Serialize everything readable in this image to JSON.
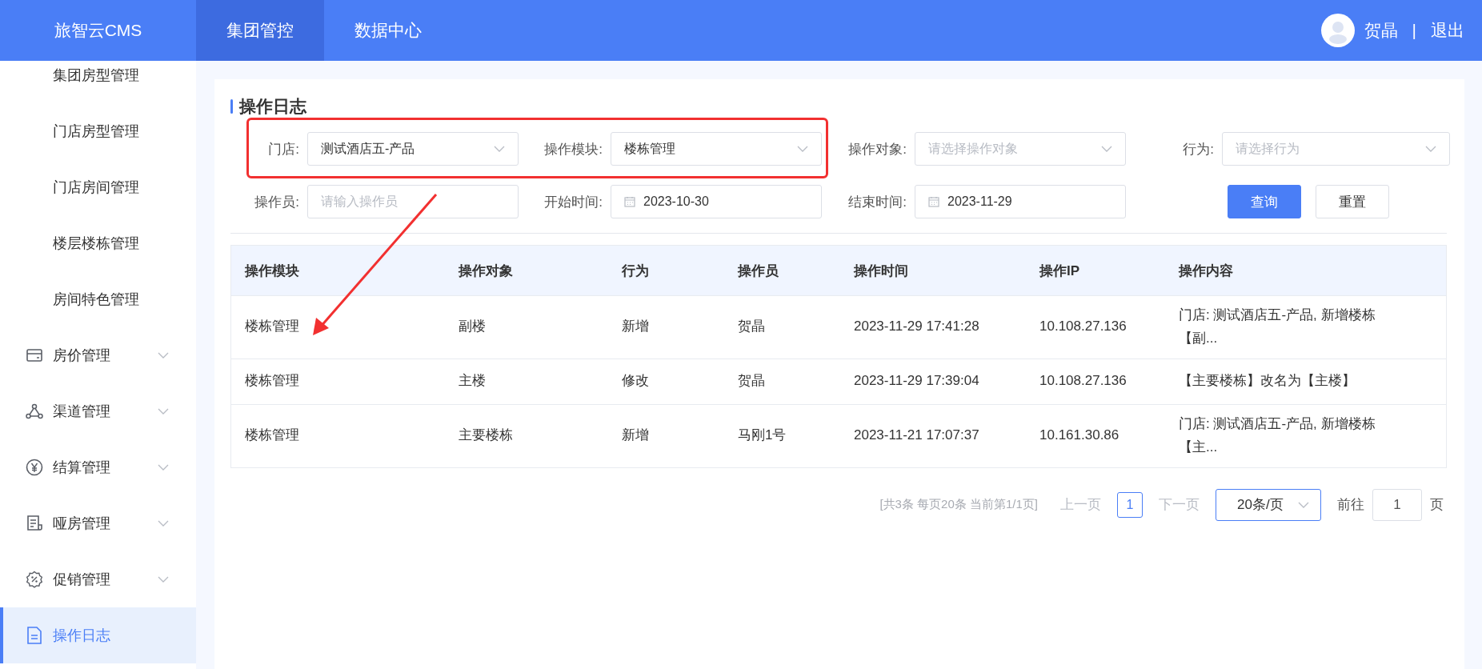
{
  "header": {
    "logo": "旅智云CMS",
    "nav": [
      {
        "label": "集团管控",
        "selected": true
      },
      {
        "label": "数据中心",
        "selected": false
      }
    ],
    "user": "贺晶",
    "separator": "|",
    "logout": "退出"
  },
  "sidebar": {
    "items": [
      {
        "kind": "link",
        "label": "集团房型管理",
        "selected": false
      },
      {
        "kind": "link",
        "label": "门店房型管理",
        "selected": false
      },
      {
        "kind": "link",
        "label": "门店房间管理",
        "selected": false
      },
      {
        "kind": "link",
        "label": "楼层楼栋管理",
        "selected": false
      },
      {
        "kind": "link",
        "label": "房间特色管理",
        "selected": false
      },
      {
        "kind": "group",
        "label": "房价管理",
        "expanded": false,
        "selected": false
      },
      {
        "kind": "group",
        "label": "渠道管理",
        "expanded": false,
        "selected": false
      },
      {
        "kind": "group",
        "label": "结算管理",
        "expanded": false,
        "selected": false
      },
      {
        "kind": "group",
        "label": "哑房管理",
        "expanded": false,
        "selected": false
      },
      {
        "kind": "group",
        "label": "促销管理",
        "expanded": false,
        "selected": false
      },
      {
        "kind": "page",
        "label": "操作日志",
        "selected": true
      }
    ]
  },
  "page": {
    "title": "操作日志",
    "filters": [
      {
        "kind": "select",
        "label": "门店:",
        "value": "测试酒店五-产品"
      },
      {
        "kind": "select",
        "label": "操作模块:",
        "value": "楼栋管理"
      },
      {
        "kind": "select",
        "label": "操作对象:",
        "placeholder": "请选择操作对象"
      },
      {
        "kind": "select",
        "label": "行为:",
        "placeholder": "请选择行为"
      },
      {
        "kind": "input",
        "label": "操作员:",
        "placeholder": "请输入操作员"
      },
      {
        "kind": "date",
        "label": "开始时间:",
        "value": "2023-10-30"
      },
      {
        "kind": "date",
        "label": "结束时间:",
        "value": "2023-11-29"
      }
    ],
    "buttons": [
      {
        "kind": "primary",
        "label": "查询"
      },
      {
        "kind": "plain",
        "label": "重置"
      }
    ],
    "table": {
      "columns": [
        "操作模块",
        "操作对象",
        "行为",
        "操作员",
        "操作时间",
        "操作IP",
        "操作内容"
      ],
      "rows": [
        [
          "楼栋管理",
          "副楼",
          "新增",
          "贺晶",
          "2023-11-29 17:41:28",
          "10.108.27.136",
          "门店: 测试酒店五-产品, 新增楼栋【副..."
        ],
        [
          "楼栋管理",
          "主楼",
          "修改",
          "贺晶",
          "2023-11-29 17:39:04",
          "10.108.27.136",
          "【主要楼栋】改名为【主楼】"
        ],
        [
          "楼栋管理",
          "主要楼栋",
          "新增",
          "马刚1号",
          "2023-11-21 17:07:37",
          "10.161.30.86",
          "门店: 测试酒店五-产品, 新增楼栋【主..."
        ]
      ]
    },
    "pagination": {
      "summary": "[共3条 每页20条 当前第1/1页]",
      "prev": {
        "label": "上一页",
        "disabled": true
      },
      "pages": [
        {
          "label": "1",
          "selected": true
        }
      ],
      "next": {
        "label": "下一页",
        "disabled": true
      },
      "page_size": "20条/页",
      "goto_label": "前往",
      "goto_value": "1",
      "goto_suffix": "页"
    }
  }
}
